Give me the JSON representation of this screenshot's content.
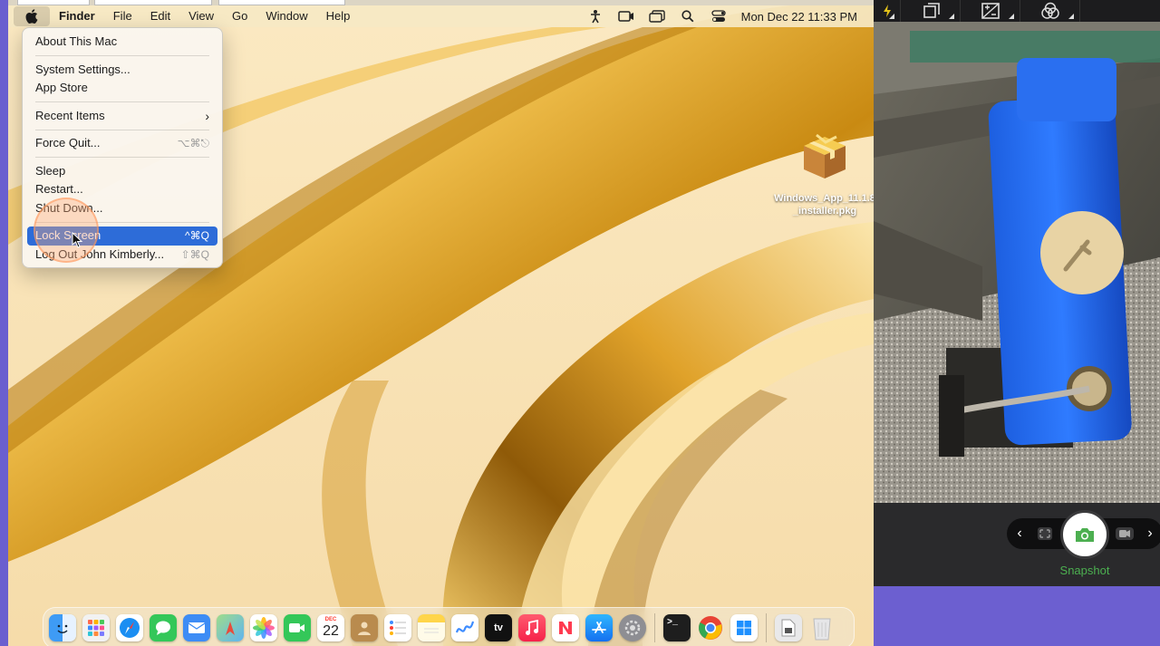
{
  "menubar": {
    "app_name": "Finder",
    "menus": [
      "File",
      "Edit",
      "View",
      "Go",
      "Window",
      "Help"
    ],
    "clock": "Mon Dec 22  11:33 PM"
  },
  "apple_menu": {
    "about": "About This Mac",
    "settings": "System Settings...",
    "app_store": "App Store",
    "recent": "Recent Items",
    "force_quit": "Force Quit...",
    "force_quit_shortcut": "⌥⌘⎋",
    "sleep": "Sleep",
    "restart": "Restart...",
    "shutdown": "Shut Down...",
    "lock": "Lock Screen",
    "lock_shortcut": "^⌘Q",
    "logout": "Log Out John Kimberly...",
    "logout_shortcut": "⇧⌘Q"
  },
  "desktop": {
    "file_name": "Windows_App_11.1.8_installer.pkg"
  },
  "dock": {
    "calendar_month": "DEC",
    "calendar_day": "22"
  },
  "camera": {
    "snapshot_label": "Snapshot"
  },
  "colors": {
    "highlight": "#2d6cd8",
    "snapshot_green": "#4caf50",
    "panel_purple": "#6c5fd0"
  }
}
